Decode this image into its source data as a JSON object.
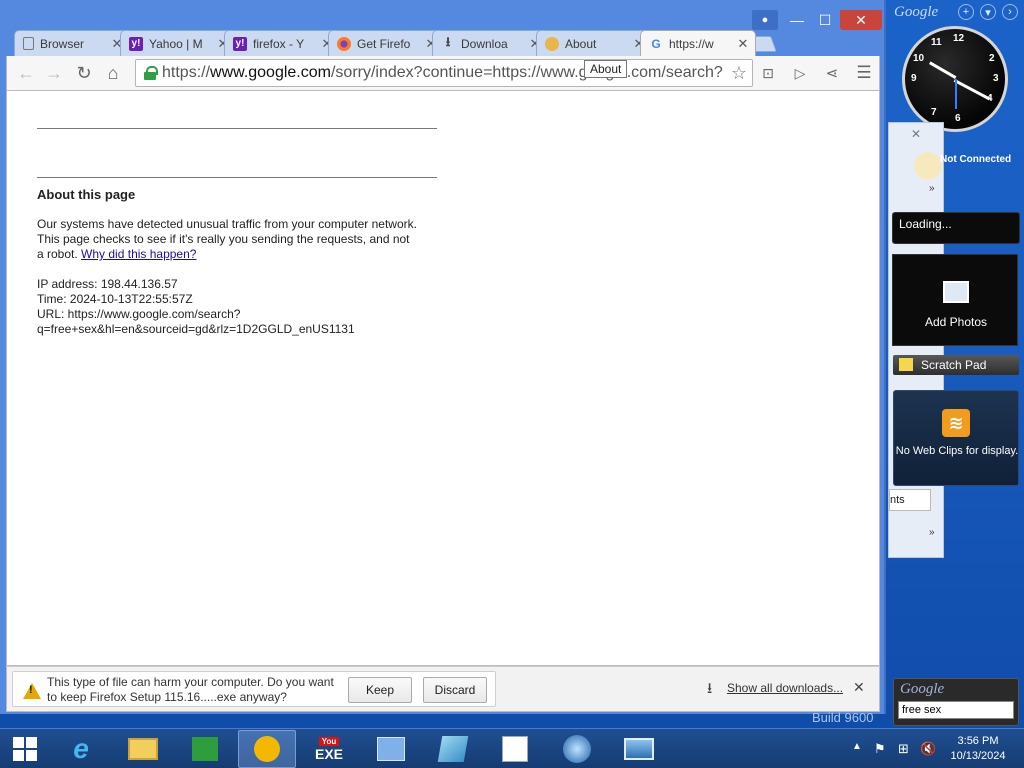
{
  "browser": {
    "tabs": [
      {
        "title": "Browser",
        "icon": "page-icon",
        "active": false
      },
      {
        "title": "Yahoo | M",
        "icon": "yahoo-icon",
        "active": false
      },
      {
        "title": "firefox - Y",
        "icon": "yahoo-icon",
        "active": false
      },
      {
        "title": "Get Firefo",
        "icon": "firefox-icon",
        "active": false
      },
      {
        "title": "Downloa",
        "icon": "download-icon",
        "active": false
      },
      {
        "title": "About",
        "icon": "about-icon",
        "active": false
      },
      {
        "title": "https://w",
        "icon": "google-icon",
        "active": true
      }
    ],
    "tooltip": "About",
    "address": {
      "scheme": "https://",
      "host": "www.google.com",
      "path": "/sorry/index?continue=https://www.google.com/search?"
    }
  },
  "page": {
    "about_title": "About this page",
    "message_line": "Our systems have detected unusual traffic from your computer network.  This page checks to see if it's really you sending the requests, and not a robot.",
    "why_link": "Why did this happen?",
    "ip_line": "IP address: 198.44.136.57",
    "time_line": "Time: 2024-10-13T22:55:57Z",
    "url_line": "URL: https://www.google.com/search?q=free+sex&hl=en&sourceid=gd&rlz=1D2GGLD_enUS1131"
  },
  "download_bar": {
    "message": "This type of file can harm your computer. Do you want to keep Firefox Setup 115.16.....exe anyway?",
    "keep_label": "Keep",
    "discard_label": "Discard",
    "show_all_label": "Show all downloads..."
  },
  "desktop": {
    "build_text": "Build 9600"
  },
  "gadgets": {
    "header_logo": "Google",
    "status": "Not Connected",
    "loading": "Loading...",
    "add_photos": "Add Photos",
    "scratch_pad": "Scratch Pad",
    "web_clips": "No Web Clips for display.",
    "partial_label": "nts",
    "search_logo": "Google",
    "search_value": "free sex"
  },
  "taskbar": {
    "time": "3:56 PM",
    "date": "10/13/2024",
    "youtube_label": "EXE"
  },
  "colors": {
    "desktop_bg": "#1a5dc0",
    "chrome_frame": "#5589e0",
    "link": "#1a0dab",
    "warning": "#e5a800",
    "close_button": "#c9453b"
  }
}
